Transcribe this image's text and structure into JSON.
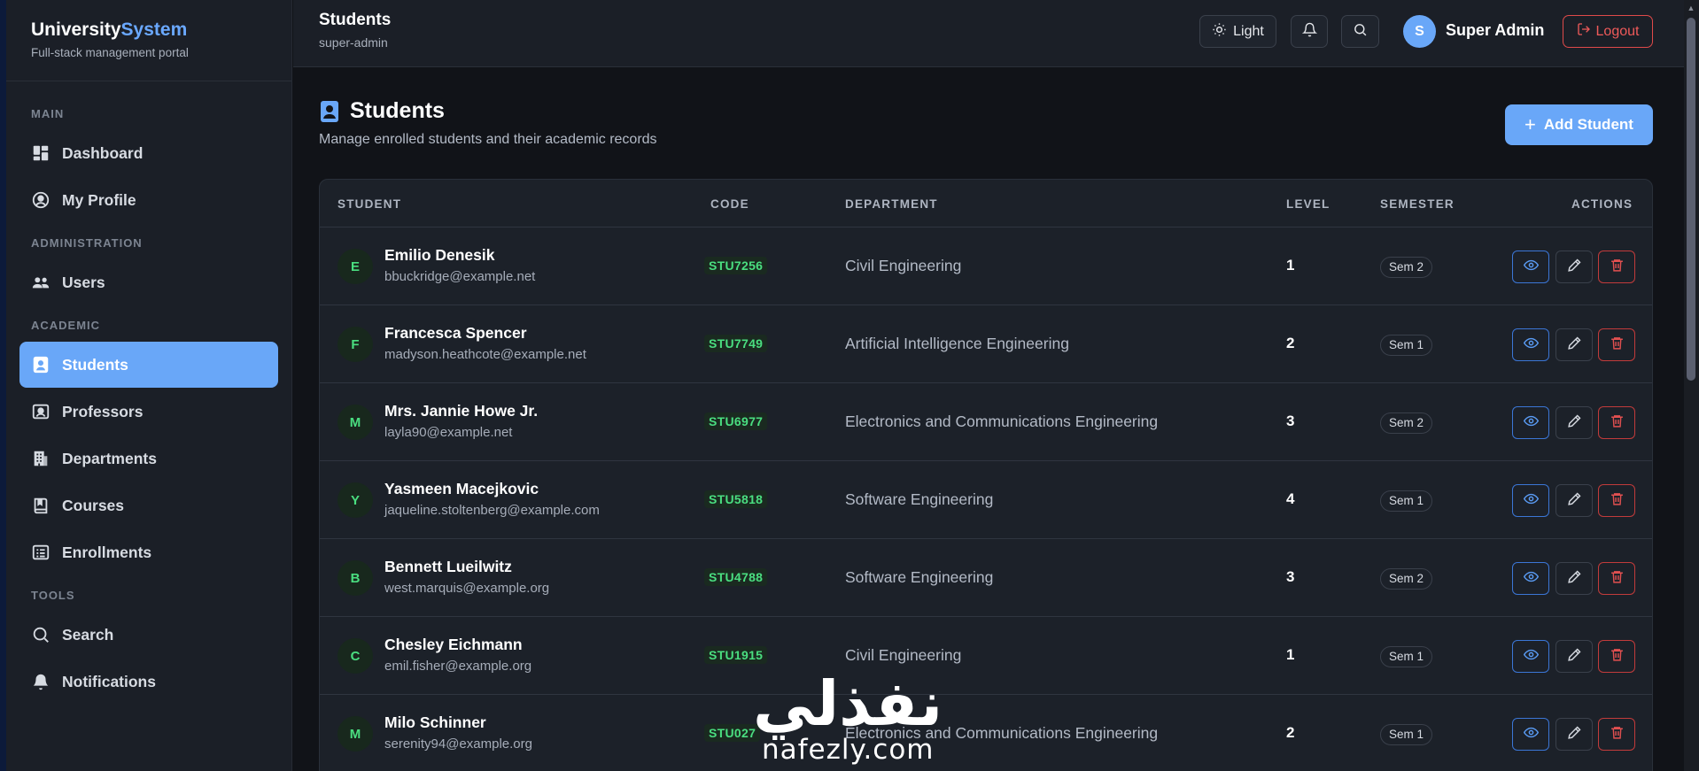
{
  "brand": {
    "title_main": "University",
    "title_accent": "System",
    "subtitle": "Full-stack management portal"
  },
  "sidebar": {
    "sections": [
      {
        "label": "MAIN",
        "items": [
          {
            "label": "Dashboard",
            "icon": "dashboard-icon"
          },
          {
            "label": "My Profile",
            "icon": "user-circle-icon"
          }
        ]
      },
      {
        "label": "ADMINISTRATION",
        "items": [
          {
            "label": "Users",
            "icon": "users-icon"
          }
        ]
      },
      {
        "label": "ACADEMIC",
        "items": [
          {
            "label": "Students",
            "icon": "student-badge-icon",
            "active": true
          },
          {
            "label": "Professors",
            "icon": "professor-icon"
          },
          {
            "label": "Departments",
            "icon": "building-icon"
          },
          {
            "label": "Courses",
            "icon": "book-icon"
          },
          {
            "label": "Enrollments",
            "icon": "list-card-icon"
          }
        ]
      },
      {
        "label": "TOOLS",
        "items": [
          {
            "label": "Search",
            "icon": "search-icon"
          },
          {
            "label": "Notifications",
            "icon": "bell-icon"
          }
        ]
      }
    ]
  },
  "header": {
    "title": "Students",
    "subtitle": "super-admin",
    "theme_label": "Light",
    "user_initial": "S",
    "user_name": "Super Admin",
    "logout_label": "Logout"
  },
  "page": {
    "title": "Students",
    "description": "Manage enrolled students and their academic records",
    "add_label": "Add Student"
  },
  "table": {
    "columns": {
      "student": "STUDENT",
      "code": "CODE",
      "department": "DEPARTMENT",
      "level": "LEVEL",
      "semester": "SEMESTER",
      "actions": "ACTIONS"
    },
    "rows": [
      {
        "initial": "E",
        "name": "Emilio Denesik",
        "email": "bbuckridge@example.net",
        "code": "STU7256",
        "department": "Civil Engineering",
        "level": "1",
        "semester": "Sem 2"
      },
      {
        "initial": "F",
        "name": "Francesca Spencer",
        "email": "madyson.heathcote@example.net",
        "code": "STU7749",
        "department": "Artificial Intelligence Engineering",
        "level": "2",
        "semester": "Sem 1"
      },
      {
        "initial": "M",
        "name": "Mrs. Jannie Howe Jr.",
        "email": "layla90@example.net",
        "code": "STU6977",
        "department": "Electronics and Communications Engineering",
        "level": "3",
        "semester": "Sem 2"
      },
      {
        "initial": "Y",
        "name": "Yasmeen Macejkovic",
        "email": "jaqueline.stoltenberg@example.com",
        "code": "STU5818",
        "department": "Software Engineering",
        "level": "4",
        "semester": "Sem 1"
      },
      {
        "initial": "B",
        "name": "Bennett Lueilwitz",
        "email": "west.marquis@example.org",
        "code": "STU4788",
        "department": "Software Engineering",
        "level": "3",
        "semester": "Sem 2"
      },
      {
        "initial": "C",
        "name": "Chesley Eichmann",
        "email": "emil.fisher@example.org",
        "code": "STU1915",
        "department": "Civil Engineering",
        "level": "1",
        "semester": "Sem 1"
      },
      {
        "initial": "M",
        "name": "Milo Schinner",
        "email": "serenity94@example.org",
        "code": "STU027",
        "department": "Electronics and Communications Engineering",
        "level": "2",
        "semester": "Sem 1"
      }
    ]
  },
  "watermark": {
    "arabic": "نفذلي",
    "latin": "nafezly.com"
  }
}
